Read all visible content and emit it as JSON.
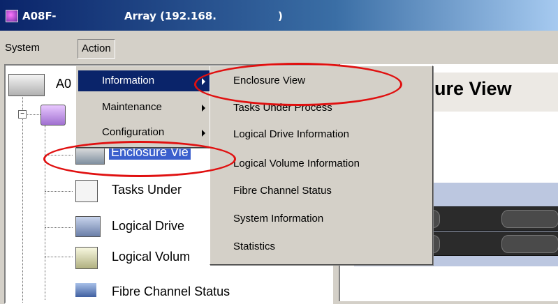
{
  "window": {
    "title_part1": "A08F-",
    "title_part2": "Array (192.168.",
    "title_part3": ")"
  },
  "menubar": {
    "items": [
      {
        "label": "System"
      },
      {
        "label": "Action"
      }
    ]
  },
  "action_menu": {
    "items": [
      {
        "label": "Information",
        "has_submenu": true,
        "highlighted": true
      },
      {
        "label": "Maintenance",
        "has_submenu": true,
        "highlighted": false
      },
      {
        "label": "Configuration",
        "has_submenu": true,
        "highlighted": false
      }
    ]
  },
  "information_submenu": {
    "items": [
      {
        "label": "Enclosure View"
      },
      {
        "label": "Tasks Under Process"
      },
      {
        "label": "Logical Drive Information"
      },
      {
        "label": "Logical Volume Information"
      },
      {
        "label": "Fibre Channel Status"
      },
      {
        "label": "System Information"
      },
      {
        "label": "Statistics"
      }
    ]
  },
  "tree": {
    "root_label": "A0",
    "items": [
      {
        "label": "Enclosure Vie",
        "selected": true
      },
      {
        "label": "Tasks Under"
      },
      {
        "label": "Logical Drive"
      },
      {
        "label": "Logical Volum"
      },
      {
        "label": "Fibre Channel Status"
      }
    ]
  },
  "content": {
    "header_title": "sure View"
  },
  "colors": {
    "highlight": "#0a246a",
    "annotation": "#e01010",
    "status_led": "#22ee22"
  }
}
